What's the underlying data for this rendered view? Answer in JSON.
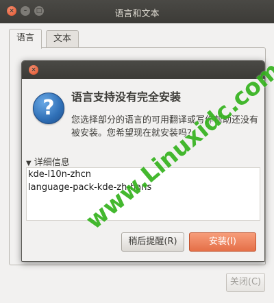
{
  "window": {
    "title": "语言和文本",
    "close_glyph": "×",
    "min_glyph": "–",
    "max_glyph": "□"
  },
  "tabs": [
    {
      "label": "语言",
      "active": true
    },
    {
      "label": "文本",
      "active": false
    }
  ],
  "footer": {
    "close_label": "关闭(C)"
  },
  "dialog": {
    "close_glyph": "×",
    "icon": "question-icon",
    "icon_glyph": "?",
    "heading": "语言支持没有完全安装",
    "message": "您选择部分的语言的可用翻译或写作帮助还没有被安装。您希望现在就安装吗？",
    "details_label": "详细信息",
    "details_arrow": "▼",
    "details_items": [
      "kde-l10n-zhcn",
      "language-pack-kde-zh-hans"
    ],
    "later_button": "稍后提醒(R)",
    "install_button": "安装(I)"
  },
  "watermark": "www.Linuxidc.com",
  "colors": {
    "titlebar": "#3c3b37",
    "accent": "#e56f47",
    "watermark": "#35b31e"
  }
}
